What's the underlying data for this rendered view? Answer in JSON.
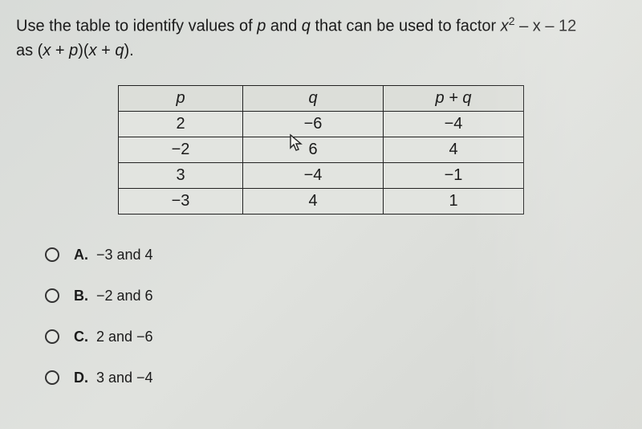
{
  "question": {
    "line1_pre": "Use the table to identify values of ",
    "p": "p",
    "and": " and ",
    "q": "q",
    "line1_mid": " that can be used to factor ",
    "expr_x2": "x",
    "expr_sup": "2",
    "expr_rest": " – x – 12",
    "line2_pre": "as (",
    "line2_x1": "x",
    "line2_plus1": " + ",
    "line2_p": "p",
    "line2_mid": ")(",
    "line2_x2": "x",
    "line2_plus2": " + ",
    "line2_q": "q",
    "line2_end": ")."
  },
  "table": {
    "headers": {
      "p": "p",
      "q": "q",
      "pq": "p + q"
    },
    "rows": [
      {
        "p": "2",
        "q": "−6",
        "pq": "−4"
      },
      {
        "p": "−2",
        "q": "6",
        "pq": "4"
      },
      {
        "p": "3",
        "q": "−4",
        "pq": "−1"
      },
      {
        "p": "−3",
        "q": "4",
        "pq": "1"
      }
    ]
  },
  "options": [
    {
      "letter": "A.",
      "text": "−3 and 4"
    },
    {
      "letter": "B.",
      "text": "−2 and 6"
    },
    {
      "letter": "C.",
      "text": "2 and −6"
    },
    {
      "letter": "D.",
      "text": "3 and −4"
    }
  ]
}
